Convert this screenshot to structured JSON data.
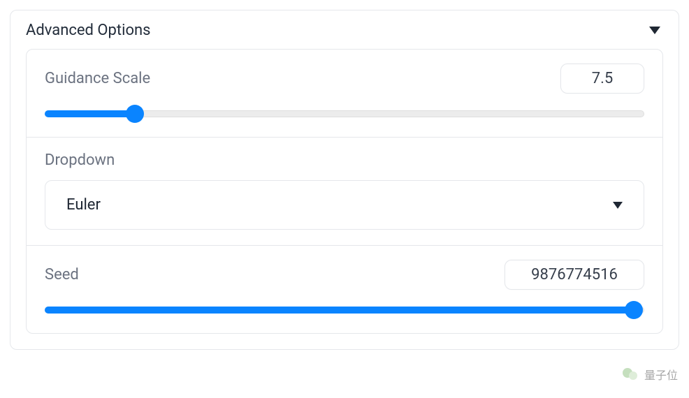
{
  "header": {
    "title": "Advanced Options"
  },
  "guidance": {
    "label": "Guidance Scale",
    "value": "7.5",
    "min": 0,
    "max": 50,
    "percent": 15
  },
  "dropdown": {
    "label": "Dropdown",
    "selected": "Euler"
  },
  "seed": {
    "label": "Seed",
    "value": "9876774516",
    "percent": 98.2
  },
  "watermark": {
    "text": "量子位"
  }
}
